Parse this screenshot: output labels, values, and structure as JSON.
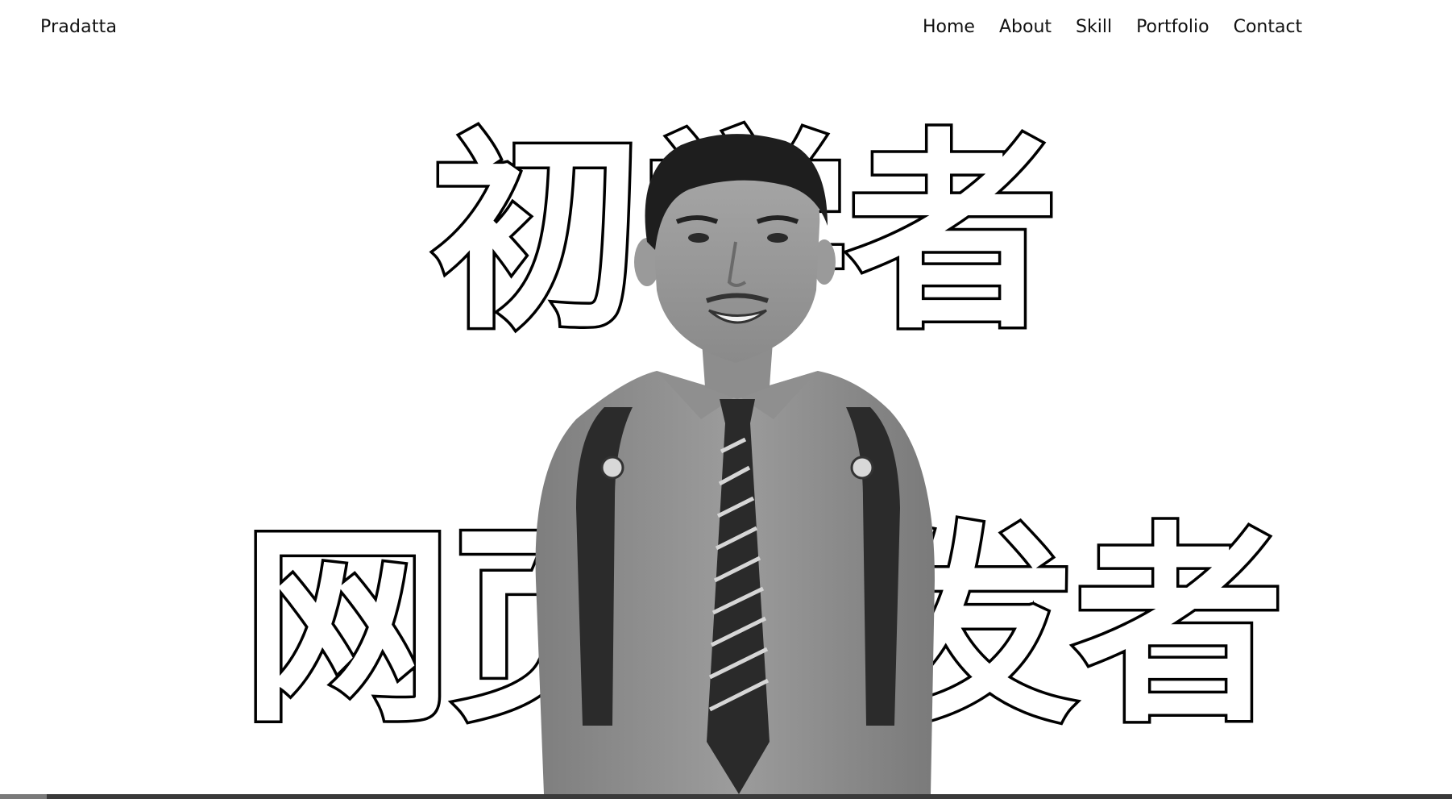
{
  "brand": "Pradatta",
  "nav": {
    "home": "Home",
    "about": "About",
    "skill": "Skill",
    "portfolio": "Portfolio",
    "contact": "Contact"
  },
  "hero": {
    "line1": "初学者",
    "line2": "网页开发者",
    "photo_icon": "person-portrait"
  },
  "colors": {
    "background": "#ffffff",
    "text": "#111111",
    "outline": "#000000"
  }
}
